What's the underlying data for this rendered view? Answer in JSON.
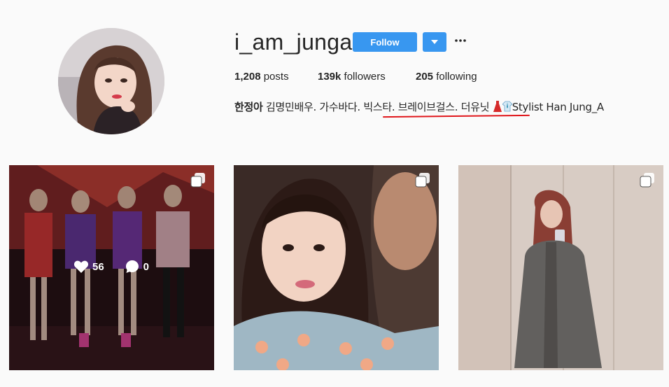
{
  "profile": {
    "username": "i_am_junga",
    "follow_label": "Follow",
    "posts_count": "1,208",
    "posts_label": "posts",
    "followers_count": "139k",
    "followers_label": "followers",
    "following_count": "205",
    "following_label": "following",
    "bio_name": "한정아",
    "bio_text_1": " 김명민배우. 가수바다. ",
    "bio_highlight": "빅스타. 브레이브걸스. 더유닛",
    "bio_text_2": "Stylist Han Jung_A"
  },
  "posts": [
    {
      "likes": "56",
      "comments": "0",
      "multi": true,
      "hovered": true
    },
    {
      "multi": true,
      "hovered": false
    },
    {
      "multi": true,
      "hovered": false
    }
  ],
  "colors": {
    "follow_blue": "#3897f0",
    "highlight_red": "#e0161b",
    "background": "#fafafa"
  },
  "icons": [
    "more-options-icon",
    "dropdown-arrow-icon",
    "multiple-photos-icon",
    "heart-icon",
    "comment-icon",
    "dress-emoji-icon",
    "shirt-emoji-icon"
  ]
}
